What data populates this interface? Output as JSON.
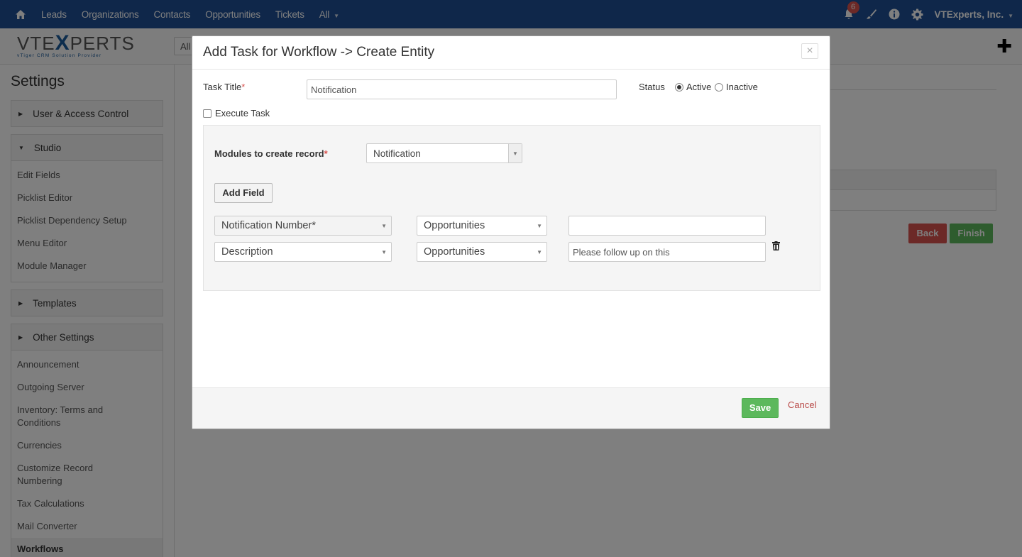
{
  "nav": {
    "links": [
      "Leads",
      "Organizations",
      "Contacts",
      "Opportunities",
      "Tickets",
      "All"
    ],
    "notification_count": "6",
    "company": "VTExperts, Inc."
  },
  "logo": {
    "brand_pre": "VTE",
    "brand_x": "X",
    "brand_post": "PERTS",
    "tagline": "vTiger CRM Solution Provider"
  },
  "search_stub": "All",
  "sidebar": {
    "title": "Settings",
    "groups": [
      {
        "label": "User & Access Control"
      },
      {
        "label": "Studio",
        "items": [
          "Edit Fields",
          "Picklist Editor",
          "Picklist Dependency Setup",
          "Menu Editor",
          "Module Manager"
        ]
      },
      {
        "label": "Templates"
      },
      {
        "label": "Other Settings",
        "items": [
          "Announcement",
          "Outgoing Server",
          "Inventory: Terms and Conditions",
          "Currencies",
          "Customize Record Numbering",
          "Tax Calculations",
          "Mail Converter",
          "Workflows"
        ]
      }
    ]
  },
  "main": {
    "back_label": "Back",
    "finish_label": "Finish"
  },
  "modal": {
    "title": "Add Task for Workflow -> Create Entity",
    "close": "×",
    "task_title_label": "Task Title",
    "required_mark": "*",
    "task_title_value": "Notification",
    "status_label": "Status",
    "status_active": "Active",
    "status_inactive": "Inactive",
    "execute_task_label": "Execute Task",
    "modules_label": "Modules to create record",
    "modules_value": "Notification",
    "add_field_label": "Add Field",
    "rows": [
      {
        "field": "Notification Number*",
        "source": "Opportunities",
        "value": ""
      },
      {
        "field": "Description",
        "source": "Opportunities",
        "value": "Please follow up on this"
      }
    ],
    "save_label": "Save",
    "cancel_label": "Cancel"
  }
}
